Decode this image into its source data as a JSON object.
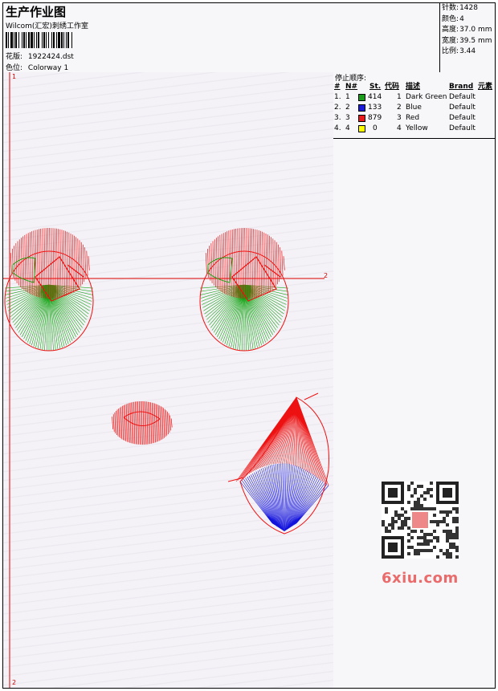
{
  "header": {
    "title": "生产作业图",
    "company": "Wilcom(汇宏)刺绣工作室",
    "design_label": "花版:",
    "design_file": "1922424.dst",
    "color_label": "色位:",
    "colorway": "Colorway 1"
  },
  "stats": [
    {
      "label": "针数",
      "value": "1428"
    },
    {
      "label": "颜色",
      "value": "4"
    },
    {
      "label": "高度",
      "value": "37.0 mm"
    },
    {
      "label": "宽度",
      "value": "39.5 mm"
    },
    {
      "label": "比例",
      "value": "3.44"
    }
  ],
  "stop_sequence": {
    "title": "停止顺序:",
    "headers": [
      "#",
      "N#",
      "St.",
      "代码",
      "描述",
      "Brand",
      "元素"
    ],
    "rows": [
      {
        "idx": "1.",
        "n": "1",
        "color": "#1a9c1a",
        "stitches": "414",
        "code": "1",
        "desc": "Dark Green",
        "brand": "Default"
      },
      {
        "idx": "2.",
        "n": "2",
        "color": "#1a1ad8",
        "stitches": "133",
        "code": "2",
        "desc": "Blue",
        "brand": "Default"
      },
      {
        "idx": "3.",
        "n": "3",
        "color": "#e81a1a",
        "stitches": "879",
        "code": "3",
        "desc": "Red",
        "brand": "Default"
      },
      {
        "idx": "4.",
        "n": "4",
        "color": "#ffff00",
        "stitches": "0",
        "code": "4",
        "desc": "Yellow",
        "brand": "Default"
      }
    ]
  },
  "canvas": {
    "ruler_marks": [
      "1",
      "2",
      "2"
    ]
  },
  "watermark": {
    "qr_text": "6xiu.com"
  },
  "colors": {
    "red": "#ee1111",
    "green": "#13a313",
    "blue": "#1212dd",
    "border": "#000000"
  }
}
